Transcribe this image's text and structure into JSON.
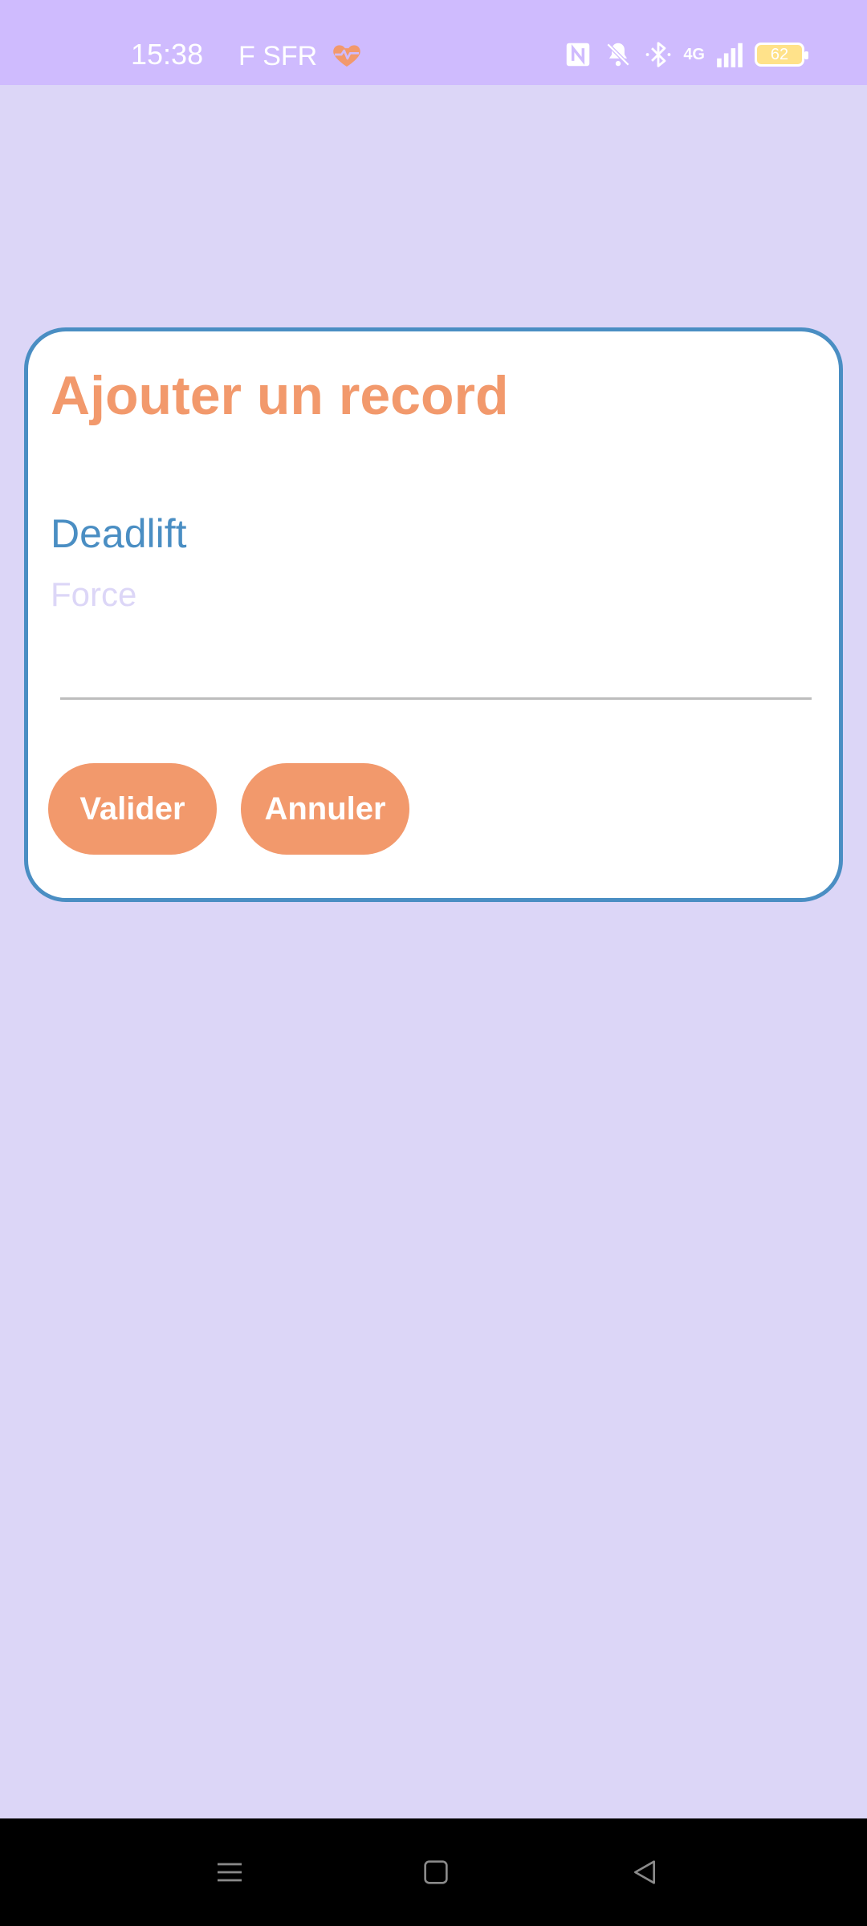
{
  "status_bar": {
    "time": "15:38",
    "carrier": "F SFR",
    "network_label": "4G",
    "battery_level": "62",
    "icons": [
      "heart-pulse-icon",
      "nfc-icon",
      "bell-off-icon",
      "bluetooth-icon",
      "signal-icon",
      "battery-icon"
    ]
  },
  "dialog": {
    "title": "Ajouter un record",
    "exercise_name": "Deadlift",
    "force_input": {
      "placeholder": "Force",
      "value": ""
    },
    "buttons": {
      "validate_label": "Valider",
      "cancel_label": "Annuler"
    }
  },
  "nav_bar": {
    "icons": [
      "menu-icon",
      "home-icon",
      "back-icon"
    ]
  },
  "colors": {
    "background": "#dcd6f7",
    "status_bar": "#cfbbfe",
    "accent_orange": "#f2996c",
    "accent_blue": "#4a8ec3",
    "card": "#ffffff"
  }
}
